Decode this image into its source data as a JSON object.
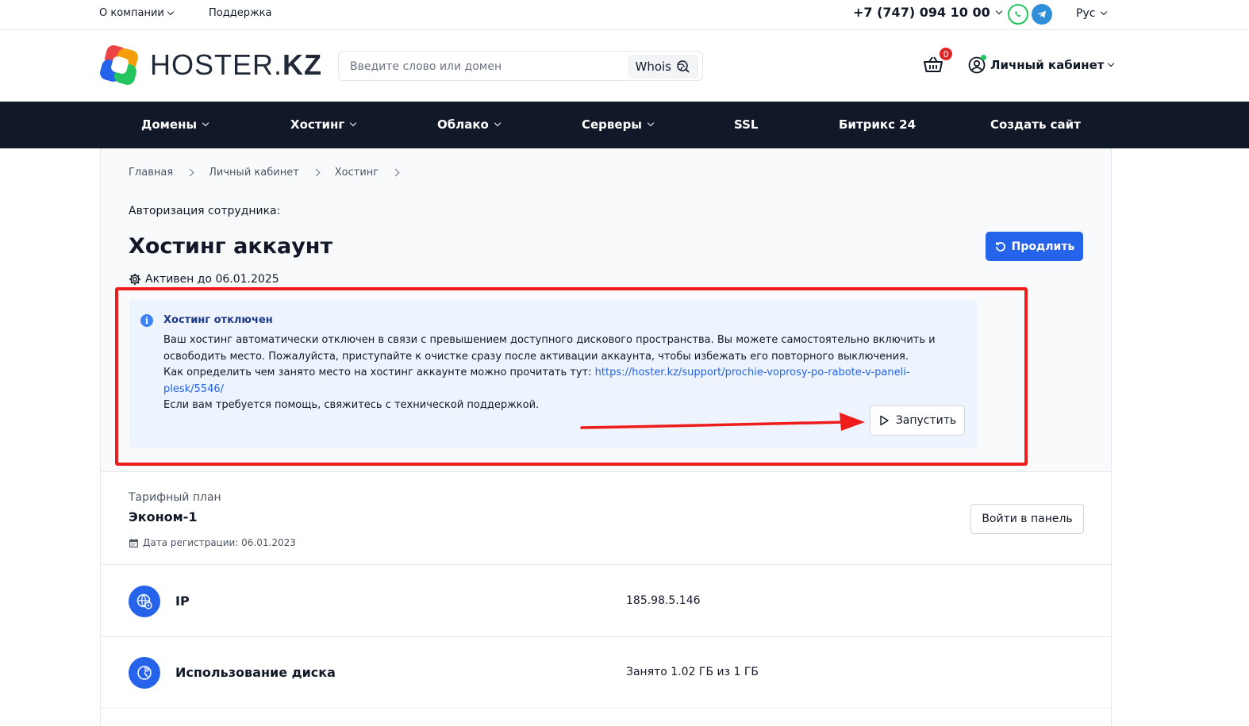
{
  "topbar": {
    "company": "О компании",
    "support": "Поддержка",
    "phone": "+7 (747) 094 10 00",
    "lang": "Рус"
  },
  "header": {
    "logo_left": "HOSTER.",
    "logo_right": "KZ",
    "search_placeholder": "Введите слово или домен",
    "whois": "Whois",
    "cart_count": "0",
    "account": "Личный кабинет"
  },
  "nav": {
    "items": [
      "Домены",
      "Хостинг",
      "Облако",
      "Серверы",
      "SSL",
      "Битрикс 24",
      "Создать сайт"
    ]
  },
  "breadcrumbs": [
    "Главная",
    "Личный кабинет",
    "Хостинг"
  ],
  "page": {
    "auth_label": "Авторизация сотрудника:",
    "title": "Хостинг аккаунт",
    "active": "Активен до 06.01.2025",
    "renew": "Продлить"
  },
  "alert": {
    "title": "Хостинг отключен",
    "line1": "Ваш хостинг автоматически отключен в связи с превышением доступного дискового пространства. Вы можете самостоятельно включить и освободить место. Пожалуйста, приступайте к очистке сразу после активации аккаунта, чтобы избежать его повторного выключения.",
    "line2_prefix": "Как определить чем занято место на хостинг аккаунте можно прочитать тут: ",
    "link": "https://hoster.kz/support/prochie-voprosy-po-rabote-v-paneli-plesk/5546/",
    "line3": "Если вам требуется помощь, свяжитесь с технической поддержкой.",
    "launch": "Запустить"
  },
  "plan": {
    "label": "Тарифный план",
    "value": "Эконом-1",
    "reg_date": "Дата регистрации: 06.01.2023",
    "panel_button": "Войти в панель"
  },
  "rows": [
    {
      "label": "IP",
      "value": "185.98.5.146",
      "icon": "globe-icon"
    },
    {
      "label": "Использование диска",
      "value": "Занято 1.02 ГБ из 1 ГБ",
      "icon": "disk-usage-icon"
    }
  ],
  "colors": {
    "nav_bg": "#111827",
    "primary": "#2563eb",
    "alert_bg": "#eef4fd",
    "annotation_red": "#ef1c1c"
  }
}
